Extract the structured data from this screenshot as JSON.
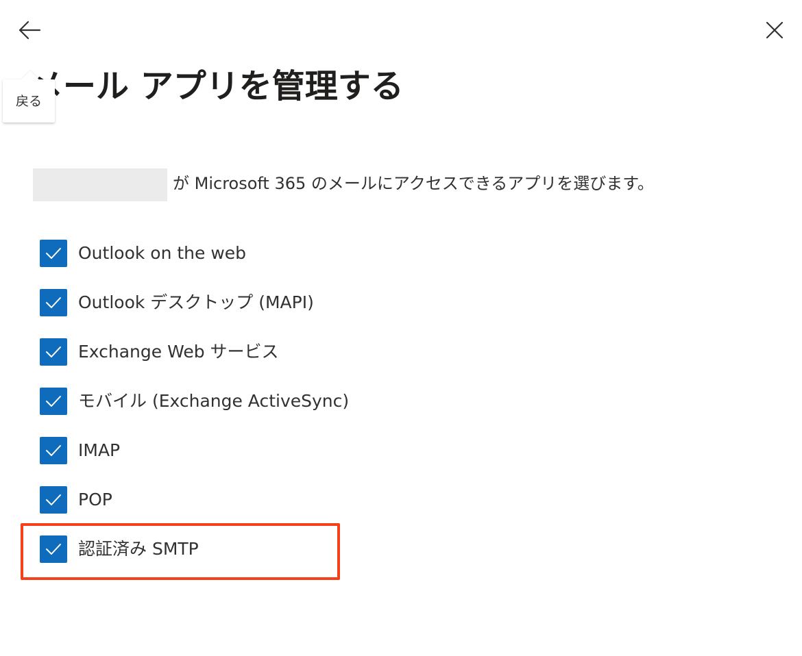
{
  "header": {
    "back_icon": "arrow-left-icon",
    "close_icon": "close-icon"
  },
  "tooltip": {
    "text": "戻る"
  },
  "title": "メール アプリを管理する",
  "description": {
    "text": "が Microsoft 365 のメールにアクセスできるアプリを選びます。"
  },
  "checkboxes": [
    {
      "label": "Outlook on the web",
      "checked": true
    },
    {
      "label": "Outlook デスクトップ (MAPI)",
      "checked": true
    },
    {
      "label": "Exchange Web サービス",
      "checked": true
    },
    {
      "label": "モバイル (Exchange ActiveSync)",
      "checked": true
    },
    {
      "label": "IMAP",
      "checked": true
    },
    {
      "label": "POP",
      "checked": true
    },
    {
      "label": "認証済み SMTP",
      "checked": true
    }
  ],
  "colors": {
    "checkbox_fill": "#0f6cbd",
    "highlight_border": "#f5401c",
    "redaction": "#ebebeb"
  }
}
